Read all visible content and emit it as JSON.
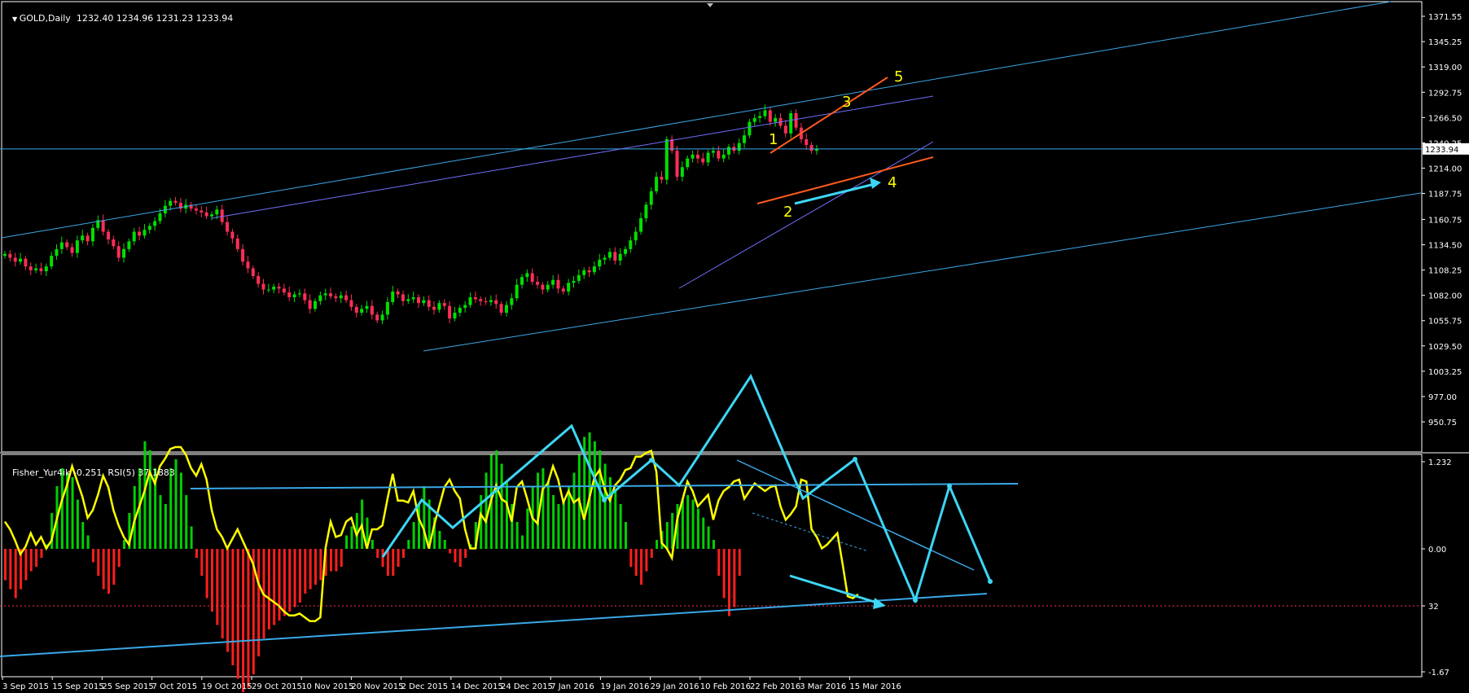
{
  "header": {
    "symbol": "GOLD,Daily",
    "ohlc": "1232.40 1234.96 1231.23 1233.94",
    "indicator": "Fisher_Yur4ik -0.251",
    "rsi": "RSI(5) 37.1883"
  },
  "colors": {
    "bull": "#00e000",
    "bear": "#ff2e57",
    "doji": "#00e000",
    "channel": "#3aa8e8",
    "purple": "#7070ff",
    "orange": "#ff5a1e",
    "wave_label": "#ffff00",
    "fisher_line": "#ffff00",
    "hist_pos": "#00d000",
    "hist_neg": "#ff1e1e",
    "arrow": "#3dd6f5",
    "grid_text": "#ffffff"
  },
  "chart_data": [
    {
      "type": "candlestick",
      "title": "GOLD,Daily",
      "ylim": [
        950.75,
        1384.4
      ],
      "y_ticks": [
        "1371.55",
        "1345.25",
        "1319.00",
        "1292.75",
        "1266.50",
        "1240.25",
        "1214.00",
        "1187.75",
        "1160.75",
        "1134.50",
        "1108.25",
        "1082.00",
        "1055.75",
        "1029.50",
        "1003.25",
        "977.00",
        "950.75"
      ],
      "current_price": "1233.94",
      "x_ticks": [
        "3 Sep 2015",
        "15 Sep 2015",
        "25 Sep 2015",
        "7 Oct 2015",
        "19 Oct 2015",
        "29 Oct 2015",
        "10 Nov 2015",
        "20 Nov 2015",
        "2 Dec 2015",
        "14 Dec 2015",
        "24 Dec 2015",
        "7 Jan 2016",
        "19 Jan 2016",
        "29 Jan 2016",
        "10 Feb 2016",
        "22 Feb 2016",
        "3 Mar 2016",
        "15 Mar 2016"
      ],
      "close": [
        1125,
        1121,
        1117,
        1120,
        1112,
        1108,
        1110,
        1107,
        1112,
        1123,
        1130,
        1137,
        1132,
        1126,
        1139,
        1144,
        1138,
        1152,
        1160,
        1148,
        1140,
        1133,
        1121,
        1130,
        1138,
        1148,
        1144,
        1150,
        1154,
        1159,
        1167,
        1175,
        1180,
        1178,
        1172,
        1176,
        1172,
        1170,
        1168,
        1164,
        1166,
        1171,
        1158,
        1148,
        1141,
        1130,
        1117,
        1110,
        1102,
        1094,
        1088,
        1088,
        1091,
        1089,
        1085,
        1080,
        1083,
        1084,
        1077,
        1068,
        1076,
        1082,
        1084,
        1081,
        1079,
        1082,
        1077,
        1070,
        1064,
        1068,
        1071,
        1062,
        1056,
        1062,
        1075,
        1086,
        1083,
        1076,
        1078,
        1080,
        1074,
        1077,
        1070,
        1067,
        1074,
        1071,
        1058,
        1064,
        1069,
        1072,
        1080,
        1078,
        1076,
        1075,
        1077,
        1073,
        1064,
        1072,
        1079,
        1093,
        1101,
        1105,
        1096,
        1093,
        1088,
        1093,
        1098,
        1089,
        1086,
        1095,
        1097,
        1103,
        1108,
        1106,
        1112,
        1119,
        1121,
        1127,
        1118,
        1125,
        1130,
        1139,
        1148,
        1162,
        1176,
        1190,
        1205,
        1202,
        1244,
        1232,
        1205,
        1215,
        1224,
        1228,
        1224,
        1220,
        1230,
        1232,
        1224,
        1228,
        1236,
        1232,
        1240,
        1248,
        1262,
        1266,
        1268,
        1274,
        1262,
        1266,
        1258,
        1250,
        1271,
        1256,
        1244,
        1238,
        1232,
        1234
      ],
      "channel_lines": "upper/lower parallel channel, purple trendlines, orange wedge",
      "wave_labels": [
        "1",
        "2",
        "3",
        "4",
        "5"
      ]
    },
    {
      "type": "histogram+line",
      "title": "Fisher_Yur4ik -0.251  RSI(5) 37.1883",
      "y_ticks": [
        "1.232",
        "0.00",
        "32",
        "-1.67"
      ],
      "rsi": [
        44,
        40,
        34,
        27,
        31,
        38,
        32,
        36,
        30,
        34,
        45,
        55,
        63,
        73,
        65,
        57,
        46,
        50,
        58,
        68,
        62,
        50,
        42,
        36,
        32,
        44,
        52,
        60,
        70,
        64,
        73,
        77,
        82,
        83,
        83,
        79,
        72,
        68,
        74,
        66,
        50,
        40,
        36,
        30,
        35,
        40,
        34,
        28,
        22,
        12,
        6,
        4,
        2,
        0,
        -3,
        -5,
        -5,
        -4,
        -6,
        -8,
        -8,
        -6,
        30,
        44,
        36,
        37,
        44,
        46,
        37,
        42,
        30,
        40,
        40,
        42,
        56,
        69,
        55,
        55,
        54,
        60,
        46,
        40,
        30,
        42,
        52,
        62,
        66,
        60,
        56,
        40,
        30,
        30,
        48,
        44,
        55,
        63,
        56,
        54,
        44,
        62,
        65,
        56,
        46,
        43,
        61,
        64,
        73,
        66,
        54,
        60,
        54,
        56,
        45,
        56,
        67,
        71,
        61,
        55,
        63,
        66,
        71,
        72,
        78,
        78,
        80,
        81,
        70,
        33,
        30,
        25,
        45,
        55,
        65,
        60,
        52,
        55,
        58,
        45,
        55,
        60,
        62,
        65,
        66,
        56,
        60,
        64,
        62,
        60,
        62,
        63,
        52,
        45,
        48,
        52,
        66,
        65,
        40,
        36,
        30,
        32,
        35,
        38,
        22,
        5,
        4,
        6
      ],
      "hist": [
        -0.35,
        -0.45,
        -0.55,
        -0.45,
        -0.35,
        -0.25,
        -0.2,
        -0.1,
        0.05,
        0.4,
        0.7,
        0.9,
        0.85,
        0.8,
        0.55,
        0.3,
        0.15,
        -0.15,
        -0.3,
        -0.45,
        -0.5,
        -0.4,
        -0.2,
        0.1,
        0.4,
        0.7,
        0.9,
        1.2,
        1.1,
        0.9,
        0.6,
        0.5,
        0.9,
        1.0,
        0.85,
        0.6,
        0.25,
        -0.1,
        -0.3,
        -0.55,
        -0.7,
        -0.85,
        -1.0,
        -1.15,
        -1.3,
        -1.45,
        -1.6,
        -1.55,
        -1.4,
        -1.2,
        -1.0,
        -0.9,
        -0.85,
        -0.8,
        -0.75,
        -0.7,
        -0.65,
        -0.6,
        -0.5,
        -0.45,
        -0.4,
        -0.35,
        -0.3,
        -0.25,
        -0.25,
        -0.2,
        0.15,
        0.25,
        0.4,
        0.55,
        0.35,
        0.1,
        -0.1,
        -0.2,
        -0.3,
        -0.3,
        -0.2,
        -0.1,
        0.1,
        0.3,
        0.5,
        0.7,
        0.55,
        0.35,
        0.2,
        0.1,
        -0.05,
        -0.15,
        -0.2,
        -0.1,
        0.05,
        0.3,
        0.6,
        0.85,
        1.05,
        1.1,
        0.95,
        0.75,
        0.5,
        0.3,
        0.15,
        0.45,
        0.7,
        0.85,
        0.9,
        0.75,
        0.6,
        0.5,
        0.55,
        0.7,
        0.85,
        1.05,
        1.25,
        1.3,
        1.2,
        1.1,
        0.95,
        0.8,
        0.65,
        0.5,
        0.3,
        -0.2,
        -0.3,
        -0.4,
        -0.25,
        -0.1,
        0.1,
        0.2,
        0.3,
        0.4,
        0.5,
        0.55,
        0.6,
        0.55,
        0.45,
        0.35,
        0.25,
        0.1,
        -0.3,
        -0.55,
        -0.75,
        -0.65,
        -0.3
      ]
    }
  ]
}
